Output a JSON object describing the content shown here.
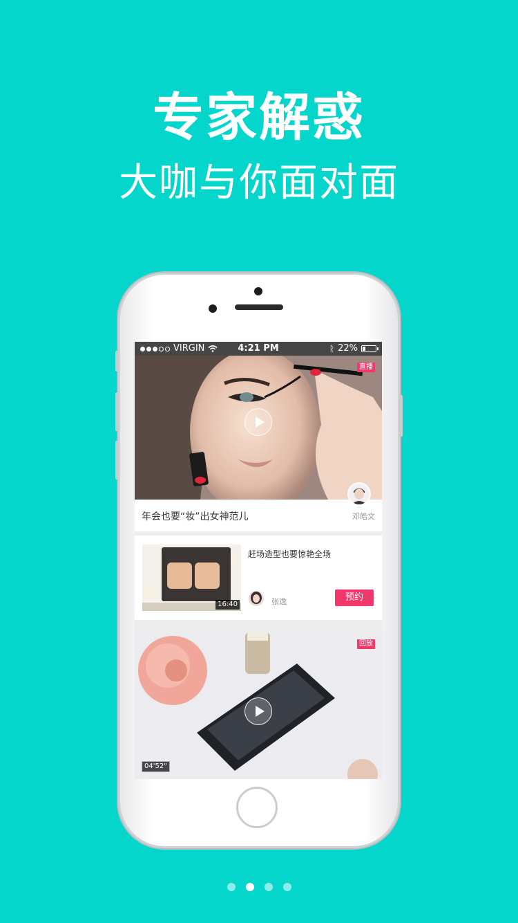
{
  "hero": {
    "title": "专家解惑",
    "subtitle": "大咖与你面对面"
  },
  "status_bar": {
    "carrier": "VIRGIN",
    "time": "4:21 PM",
    "battery": "22%",
    "battery_level": 0.22
  },
  "feed": {
    "live_card": {
      "badge": "直播",
      "title": "年会也要“妆”出女神范儿",
      "author": "邓皓文"
    },
    "booking_card": {
      "title": "赶场造型也要惊艳全场",
      "duration": "16:40",
      "author": "张逸",
      "reserve_label": "预约"
    },
    "replay_card": {
      "badge": "回放",
      "duration": "04'52\""
    }
  },
  "pagination": {
    "total": 4,
    "active_index": 1
  },
  "colors": {
    "background": "#05d6cb",
    "accent": "#f0386b"
  }
}
